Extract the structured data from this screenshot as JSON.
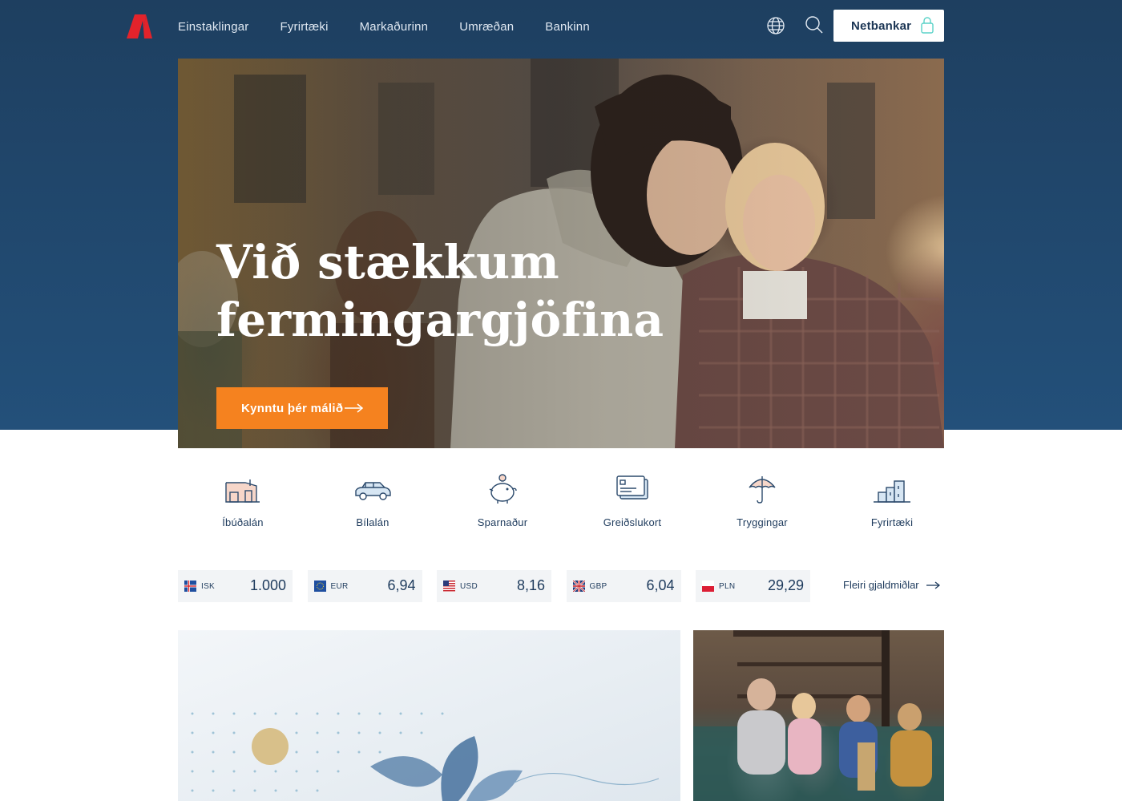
{
  "header": {
    "logo_name": "bank-logo",
    "nav": [
      "Einstaklingar",
      "Fyrirtæki",
      "Markaðurinn",
      "Umræðan",
      "Bankinn"
    ],
    "netbank_label": "Netbankar"
  },
  "hero": {
    "title": "Við stækkum fermingargjöfina",
    "cta_label": "Kynntu þér málið"
  },
  "quick_links": [
    {
      "label": "Íbúðalán",
      "icon": "house-icon"
    },
    {
      "label": "Bílalán",
      "icon": "car-icon"
    },
    {
      "label": "Sparnaður",
      "icon": "piggy-bank-icon"
    },
    {
      "label": "Greiðslukort",
      "icon": "credit-card-icon"
    },
    {
      "label": "Tryggingar",
      "icon": "umbrella-icon"
    },
    {
      "label": "Fyrirtæki",
      "icon": "buildings-icon"
    }
  ],
  "rates": [
    {
      "code": "ISK",
      "value": "1.000"
    },
    {
      "code": "EUR",
      "value": "6,94"
    },
    {
      "code": "USD",
      "value": "8,16"
    },
    {
      "code": "GBP",
      "value": "6,04"
    },
    {
      "code": "PLN",
      "value": "29,29"
    }
  ],
  "more_rates_label": "Fleiri gjaldmiðlar",
  "colors": {
    "header_bg": "#1e3f60",
    "accent_orange": "#f5821f",
    "brand_red": "#e3232b",
    "text_navy": "#1d3a5c"
  }
}
